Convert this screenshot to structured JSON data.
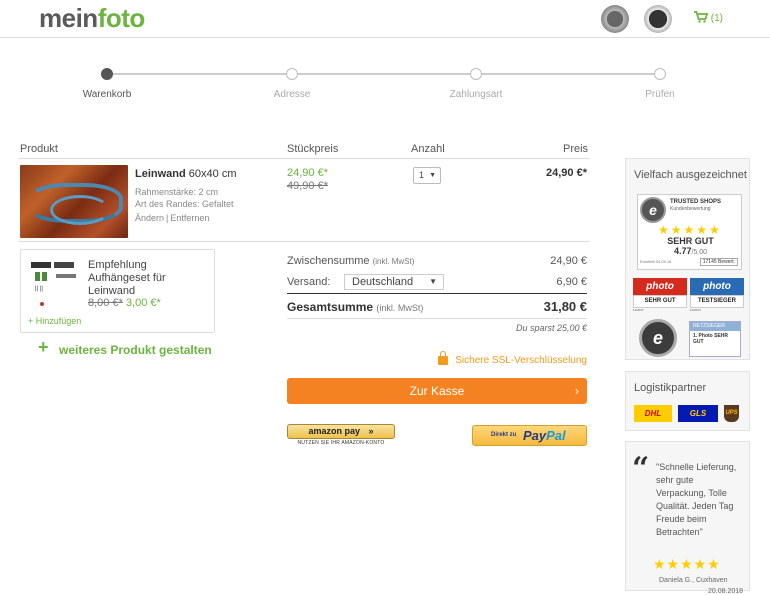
{
  "header": {
    "logo_main": "mein",
    "logo_accent": "foto",
    "cart_count": "(1)",
    "colors": {
      "brand_green": "#6cb33f",
      "accent_orange": "#f58220"
    }
  },
  "steps": [
    {
      "label": "Warenkorb",
      "active": true
    },
    {
      "label": "Adresse",
      "active": false
    },
    {
      "label": "Zahlungsart",
      "active": false
    },
    {
      "label": "Prüfen",
      "active": false
    }
  ],
  "table": {
    "col_product": "Produkt",
    "col_unit_price": "Stückpreis",
    "col_qty": "Anzahl",
    "col_price": "Preis"
  },
  "item": {
    "name": "Leinwand",
    "size": "60x40 cm",
    "meta1": "Rahmenstärke: 2 cm",
    "meta2": "Art des Randes: Gefaltet",
    "edit": "Ändern",
    "separator": "|",
    "remove": "Entfernen",
    "price_new": "24,90 €*",
    "price_old": "49,90 €*",
    "qty": "1",
    "total": "24,90 €*"
  },
  "recommendation": {
    "title_line1": "Empfehlung",
    "title_line2": "Aufhängeset für",
    "title_line3": "Leinwand",
    "price_old": "8,00 €*",
    "price_new": "3,00 €*",
    "add": "+ Hinzufügen"
  },
  "more": {
    "plus": "+",
    "label": "weiteres Produkt gestalten"
  },
  "summary": {
    "subtotal_label": "Zwischensumme",
    "subtotal_note": "(inkl. MwSt)",
    "subtotal_value": "24,90 €",
    "shipping_label": "Versand:",
    "shipping_country": "Deutschland",
    "shipping_value": "6,90 €",
    "total_label": "Gesamtsumme",
    "total_note": "(inkl. MwSt)",
    "total_value": "31,80 €",
    "savings": "Du sparst 25,00 €",
    "ssl": "Sichere SSL-Verschlüsselung",
    "checkout": "Zur Kasse",
    "checkout_arrow": "›",
    "amazon_label": "amazon pay",
    "amazon_arrows": "»",
    "amazon_sub": "NUTZEN SIE IHR AMAZON-KONTO",
    "paypal_prefix": "Direkt zu",
    "paypal_pay": "Pay",
    "paypal_pal": "Pal"
  },
  "sidebar": {
    "awards_title": "Vielfach ausgezeichnet",
    "ts_header": "TRUSTED SHOPS",
    "ts_sub": "Kundenbewertung",
    "ts_stars": "★★★★★",
    "ts_grade": "SEHR GUT",
    "ts_score": "4.77",
    "ts_score_max": "/5.00",
    "ts_foot": "Ermittelt 04.09.18",
    "ts_count": "17145 Bewert.",
    "award1_brand": "photo",
    "award1_text": "SEHR GUT",
    "award1_date": "11/2017",
    "award2_brand": "photo",
    "award2_text": "TESTSIEGER",
    "award2_date": "11/2014",
    "seal_letter": "e",
    "ts_small_head": "NETZSIEGER",
    "ts_small_text": "1. Photo SEHR GUT",
    "logistics_title": "Logistikpartner",
    "logistics": [
      "DHL",
      "GLS",
      "UPS"
    ],
    "quote_mark": "“",
    "quote": "\"Schnelle Lieferung, sehr gute Verpackung, Tolle Qualität. Jeden Tag Freude beim Betrachten\"",
    "quote_stars": "★★★★★",
    "quote_author": "Daniela G., Cuxhaven",
    "quote_date": "20.08.2018"
  }
}
